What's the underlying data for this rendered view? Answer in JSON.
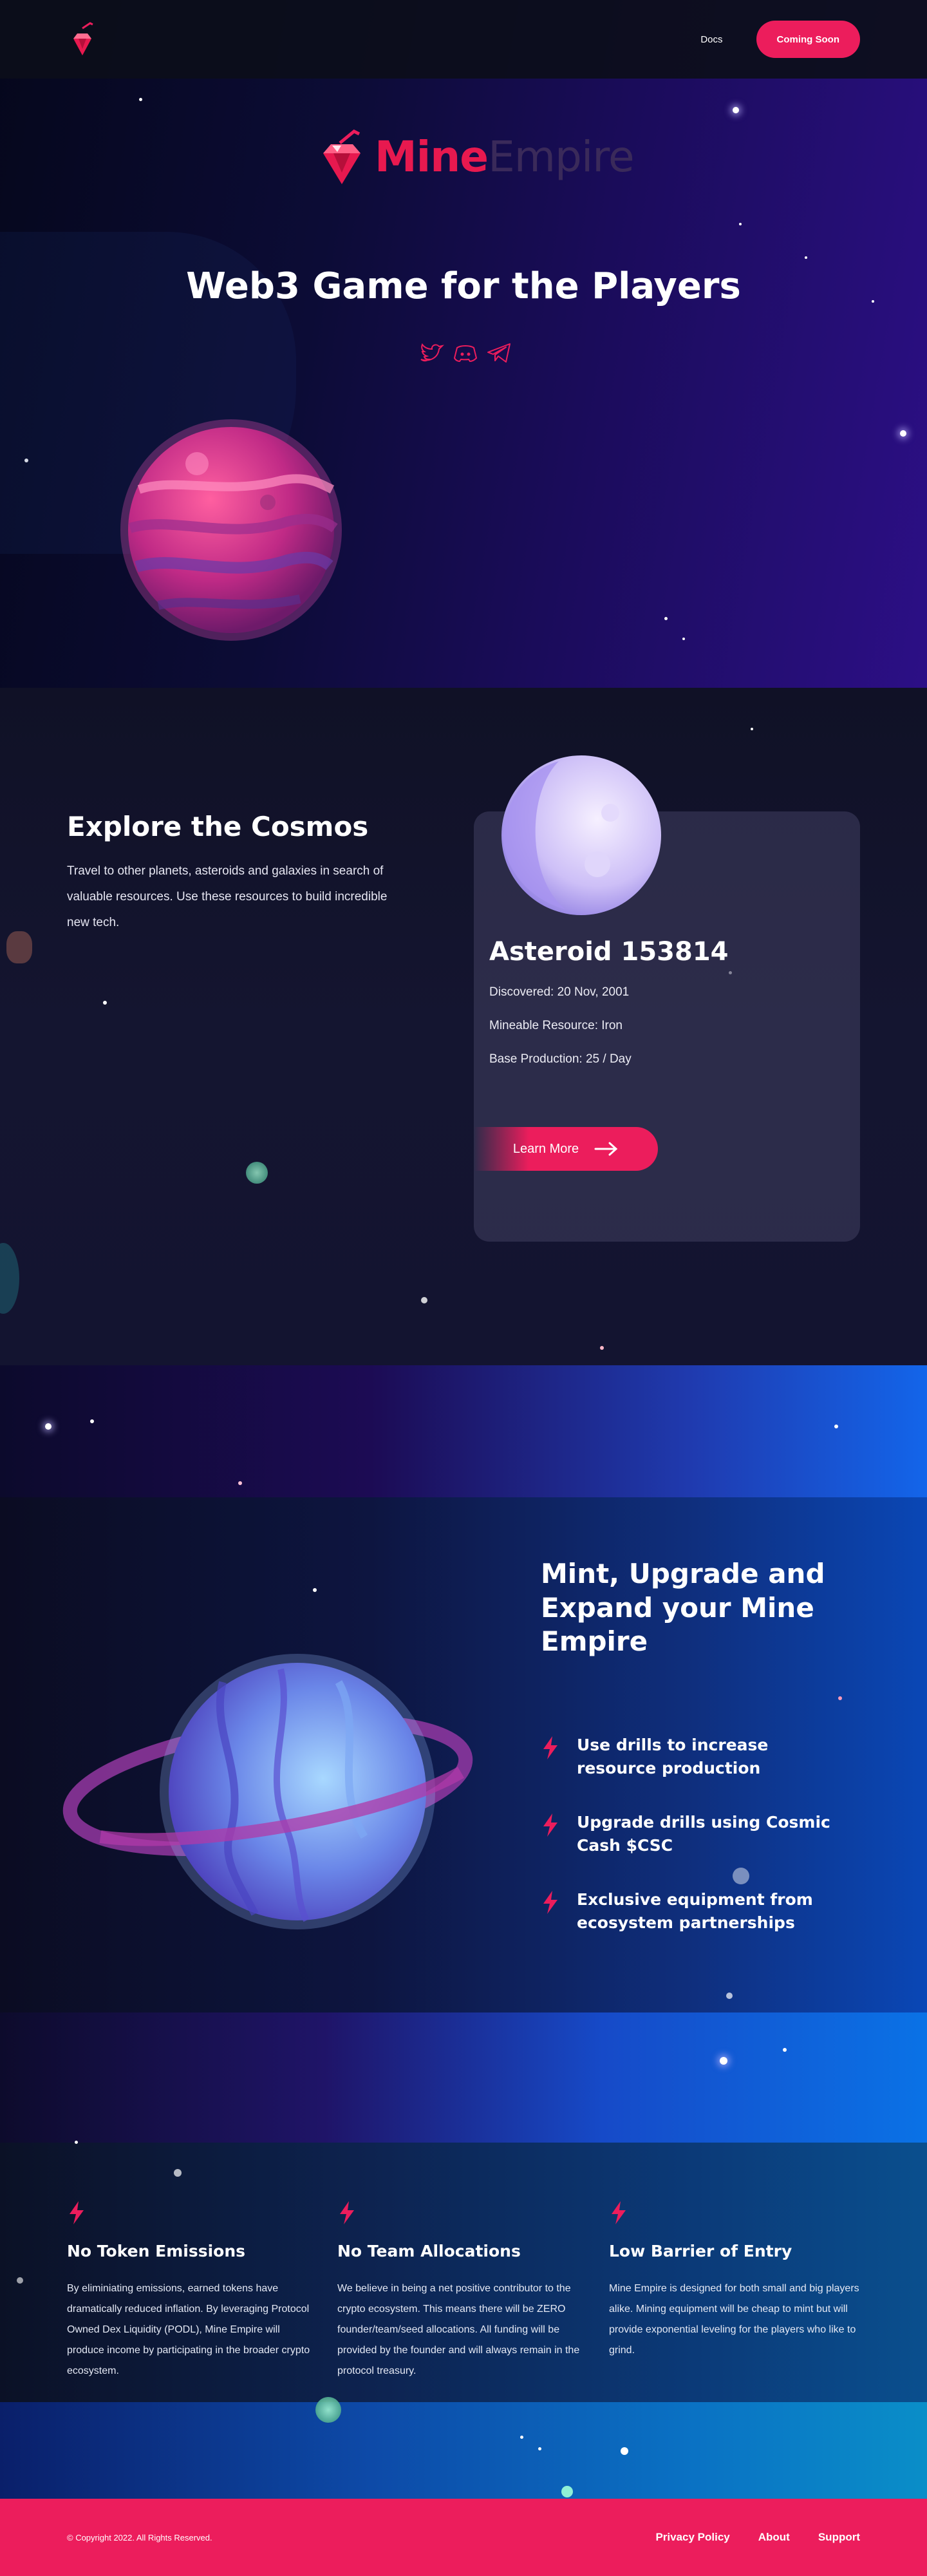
{
  "header": {
    "logo": "mine-empire-gem-pickaxe-logo",
    "nav": [
      {
        "label": "Docs"
      }
    ],
    "cta_label": "Coming Soon"
  },
  "hero": {
    "brand_mine": "Mine",
    "brand_empire": "Empire",
    "title": "Web3 Game for the Players",
    "socials": [
      "twitter-icon",
      "discord-icon",
      "telegram-icon"
    ]
  },
  "explore": {
    "title": "Explore the Cosmos",
    "text": "Travel to other planets, asteroids and galaxies in search of valuable resources. Use these resources to build incredible new tech.",
    "card": {
      "title": "Asteroid 153814",
      "discovered": "Discovered: 20 Nov, 2001",
      "resource": "Mineable Resource: Iron",
      "production": "Base Production: 25 / Day",
      "button": "Learn More"
    }
  },
  "mint": {
    "title": "Mint, Upgrade and Expand your Mine Empire",
    "features": [
      "Use drills to increase resource production",
      "Upgrade drills using Cosmic Cash $CSC",
      "Exclusive equipment from ecosystem partnerships"
    ]
  },
  "pillars": [
    {
      "title": "No Token Emissions",
      "text": "By eliminiating emissions, earned tokens have dramatically reduced inflation. By leveraging Protocol Owned Dex Liquidity (PODL), Mine Empire will produce income by participating in the broader crypto ecosystem."
    },
    {
      "title": "No Team Allocations",
      "text": "We believe in being a net positive contributor to the crypto ecosystem. This means there will be ZERO founder/team/seed allocations. All funding will be provided by the founder and will always remain in the protocol treasury."
    },
    {
      "title": "Low Barrier of Entry",
      "text": "Mine Empire is designed for both small and big players alike. Mining equipment will be cheap to mint but will provide exponential leveling for the players who like to grind."
    }
  ],
  "footer": {
    "copyright": "© Copyright 2022. All Rights Reserved.",
    "links": [
      "Privacy Policy",
      "About",
      "Support"
    ]
  },
  "colors": {
    "accent": "#ec1d5c",
    "brand_red": "#e7194f"
  }
}
